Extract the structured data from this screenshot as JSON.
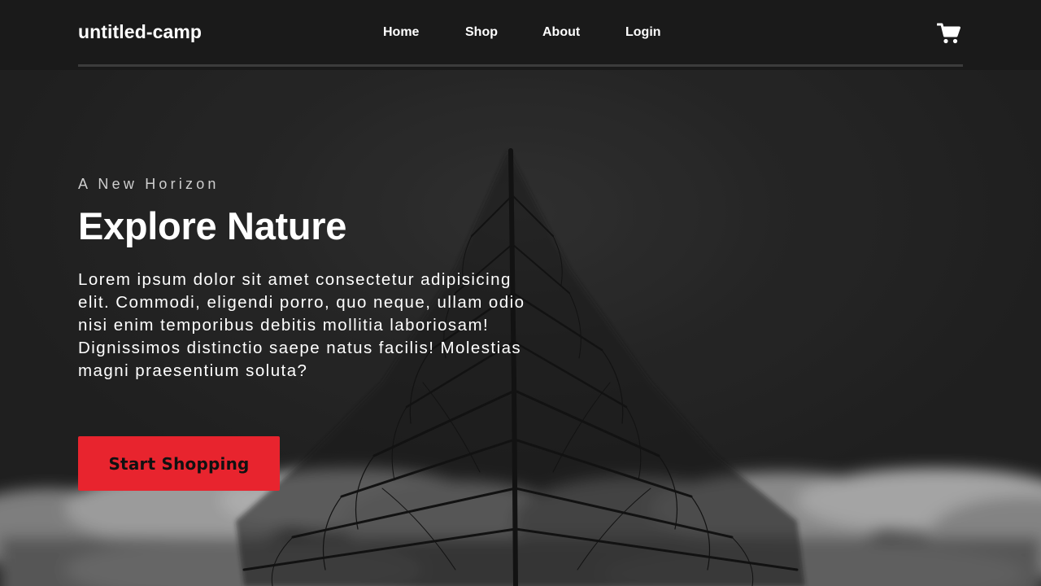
{
  "header": {
    "brand": "untitled-camp",
    "nav": [
      {
        "label": "Home"
      },
      {
        "label": "Shop"
      },
      {
        "label": "About"
      },
      {
        "label": "Login"
      }
    ],
    "cart_icon": "shopping-cart-icon"
  },
  "hero": {
    "tagline": "A New Horizon",
    "headline": "Explore Nature",
    "body": "Lorem ipsum dolor sit amet consectetur adipisicing elit. Commodi, eligendi porro, quo neque, ullam odio nisi enim temporibus debitis mollitia laboriosam! Dignissimos distinctio saepe natus facilis! Molestias magni praesentium soluta?",
    "cta_label": "Start Shopping",
    "background_image": "tree-above-clouds-photo"
  },
  "colors": {
    "header_bg": "#1a1a1a",
    "accent": "#e8242e",
    "text": "#ffffff"
  }
}
